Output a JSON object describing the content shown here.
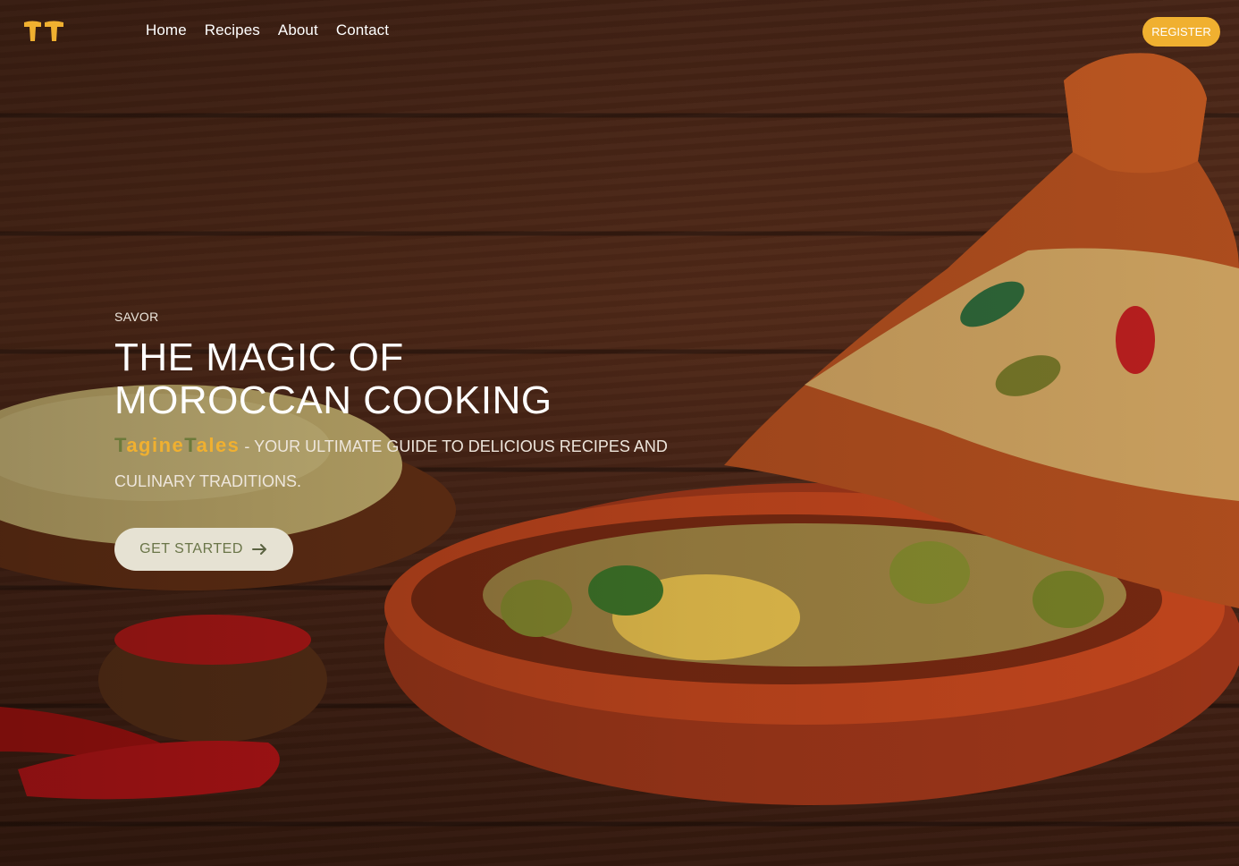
{
  "header": {
    "logo_icon": "tt-logo-icon",
    "nav": [
      {
        "label": "Home"
      },
      {
        "label": "Recipes"
      },
      {
        "label": "About"
      },
      {
        "label": "Contact"
      }
    ],
    "register_label": "REGISTER"
  },
  "hero": {
    "eyebrow": "SAVOR",
    "title_line1": "THE MAGIC OF",
    "title_line2": "MOROCCAN COOKING",
    "brand_part1_cap": "T",
    "brand_part1_rest": "agine",
    "brand_part2_cap": "T",
    "brand_part2_rest": "ales",
    "tagline_rest": " - YOUR ULTIMATE GUIDE TO DELICIOUS RECIPES AND CULINARY TRADITIONS.",
    "cta_label": "GET STARTED",
    "cta_icon": "arrow-right-icon"
  },
  "colors": {
    "accent": "#f0b030",
    "brand_olive": "#6c7a3a",
    "cta_bg": "#e6e2d3",
    "cta_text": "#6a7548"
  }
}
